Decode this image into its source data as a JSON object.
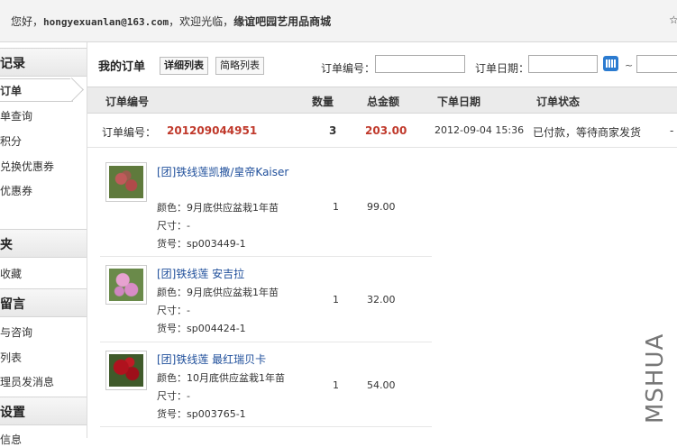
{
  "topbar": {
    "greeting": "您好，",
    "email": "hongyexuanlan@163.com",
    "welcome": "，欢迎光临，",
    "shop_name": "缘谊吧园艺用品商城",
    "right_text": "☆"
  },
  "sidebar": {
    "section1": "记录",
    "items1": [
      "订单",
      "单查询",
      "积分",
      "兑换优惠券",
      "优惠券"
    ],
    "section2": "夹",
    "items2": [
      "收藏"
    ],
    "section3": "留言",
    "items3": [
      "与咨询",
      "列表",
      "理员发消息"
    ],
    "section4": "设置",
    "items4": [
      "信息"
    ]
  },
  "main": {
    "heading": "我的订单",
    "tab_detail": "详细列表",
    "tab_brief": "简略列表",
    "order_no_label": "订单编号：",
    "order_date_label": "订单日期：",
    "tilde": "~",
    "columns": [
      "订单编号",
      "数量",
      "总金额",
      "下单日期",
      "订单状态"
    ],
    "order": {
      "label": "订单编号：",
      "number": "201209044951",
      "quantity": "3",
      "total": "203.00",
      "date": "2012-09-04 15:36",
      "status": "已付款，等待商家发货",
      "extra": "-"
    },
    "products": [
      {
        "name": "[团]铁线莲凯撒/皇帝Kaiser",
        "color": "颜色：9月底供应盆栽1年苗",
        "size": "尺寸：-",
        "sku": "货号：sp003449-1",
        "qty": "1",
        "price": "99.00"
      },
      {
        "name": "[团]铁线莲 安吉拉",
        "color": "颜色：9月底供应盆栽1年苗",
        "size": "尺寸：-",
        "sku": "货号：sp004424-1",
        "qty": "1",
        "price": "32.00"
      },
      {
        "name": "[团]铁线莲 最红瑞贝卡",
        "color": "颜色：10月底供应盆栽1年苗",
        "size": "尺寸：-",
        "sku": "货号：sp003765-1",
        "qty": "1",
        "price": "54.00"
      }
    ]
  },
  "watermark": "MSHUA",
  "colors": {
    "accent_red": "#c0392b",
    "link_blue": "#1f4f9b",
    "calendar_blue": "#2b7bd0"
  },
  "icons": {
    "calendar": "calendar-icon"
  }
}
